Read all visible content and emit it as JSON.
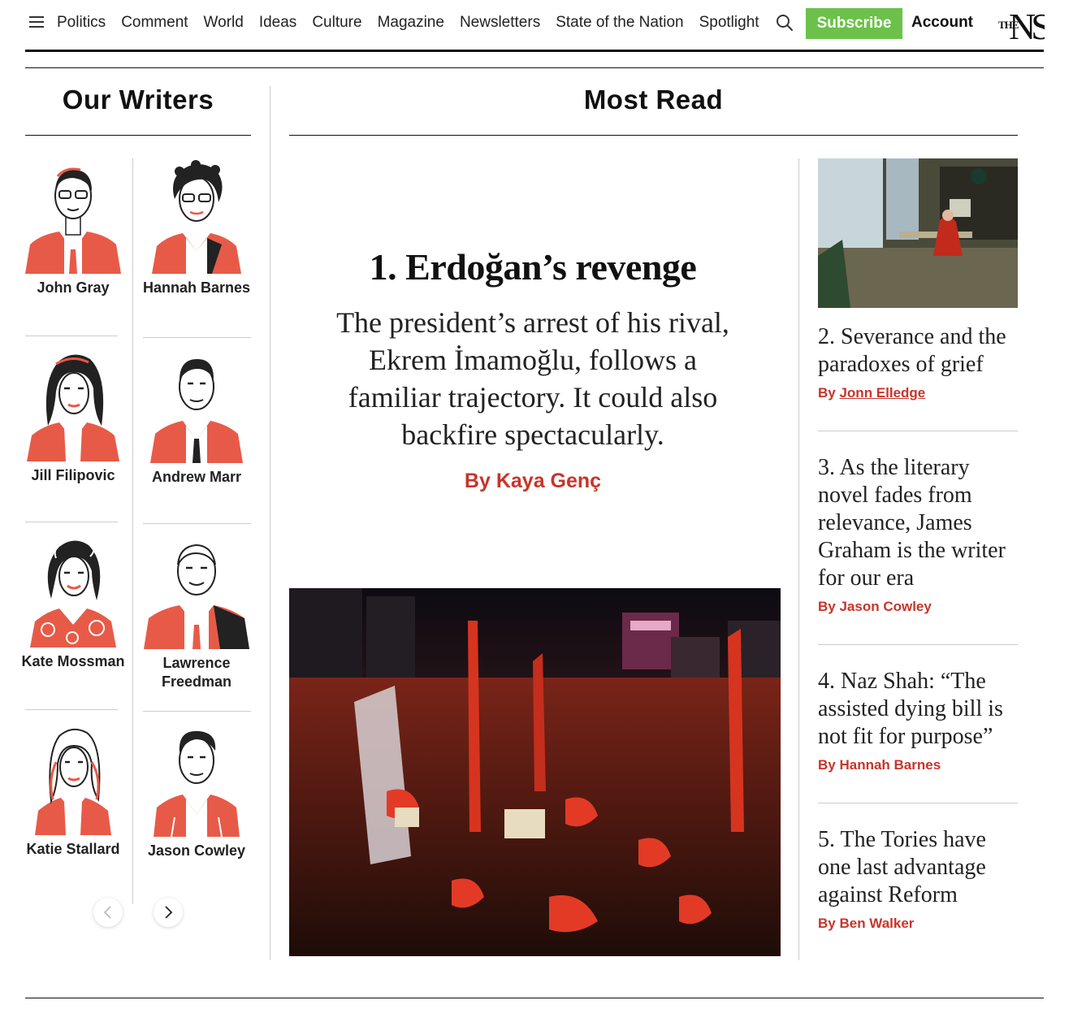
{
  "nav": {
    "items": [
      "Politics",
      "Comment",
      "World",
      "Ideas",
      "Culture",
      "Magazine",
      "Newsletters",
      "State of the Nation",
      "Spotlight"
    ],
    "subscribe_label": "Subscribe",
    "account_label": "Account",
    "logo_the": "THE",
    "logo_ns": "NS",
    "subscribe_color": "#6cc14a"
  },
  "writers": {
    "title": "Our Writers",
    "list": [
      {
        "name": "John Gray"
      },
      {
        "name": "Hannah Barnes"
      },
      {
        "name": "Jill Filipovic"
      },
      {
        "name": "Andrew Marr"
      },
      {
        "name": "Kate Mossman"
      },
      {
        "name": "Lawrence Freedman"
      },
      {
        "name": "Katie Stallard"
      },
      {
        "name": "Jason Cowley"
      }
    ],
    "accent": "#e85a48"
  },
  "most_read": {
    "title": "Most Read",
    "featured": {
      "title": "1. Erdoğan’s revenge",
      "dek": "The president’s arrest of his rival, Ekrem İmamoğlu, follows a familiar trajectory. It could also backfire spectacularly.",
      "byline": "By Kaya Genç"
    },
    "articles": [
      {
        "title": "2. Severance and the paradoxes of grief",
        "by": "By",
        "author": "Jonn Elledge"
      },
      {
        "title": "3. As the literary novel fades from relevance, James Graham is the writer for our era",
        "by": "By",
        "author": "Jason Cowley"
      },
      {
        "title": "4. Naz Shah: “The assisted dying bill is not fit for purpose”",
        "by": "By",
        "author": "Hannah Barnes"
      },
      {
        "title": "5. The Tories have one last advantage against Reform",
        "by": "By",
        "author": "Ben Walker"
      }
    ],
    "byline_color": "#c8342a"
  }
}
